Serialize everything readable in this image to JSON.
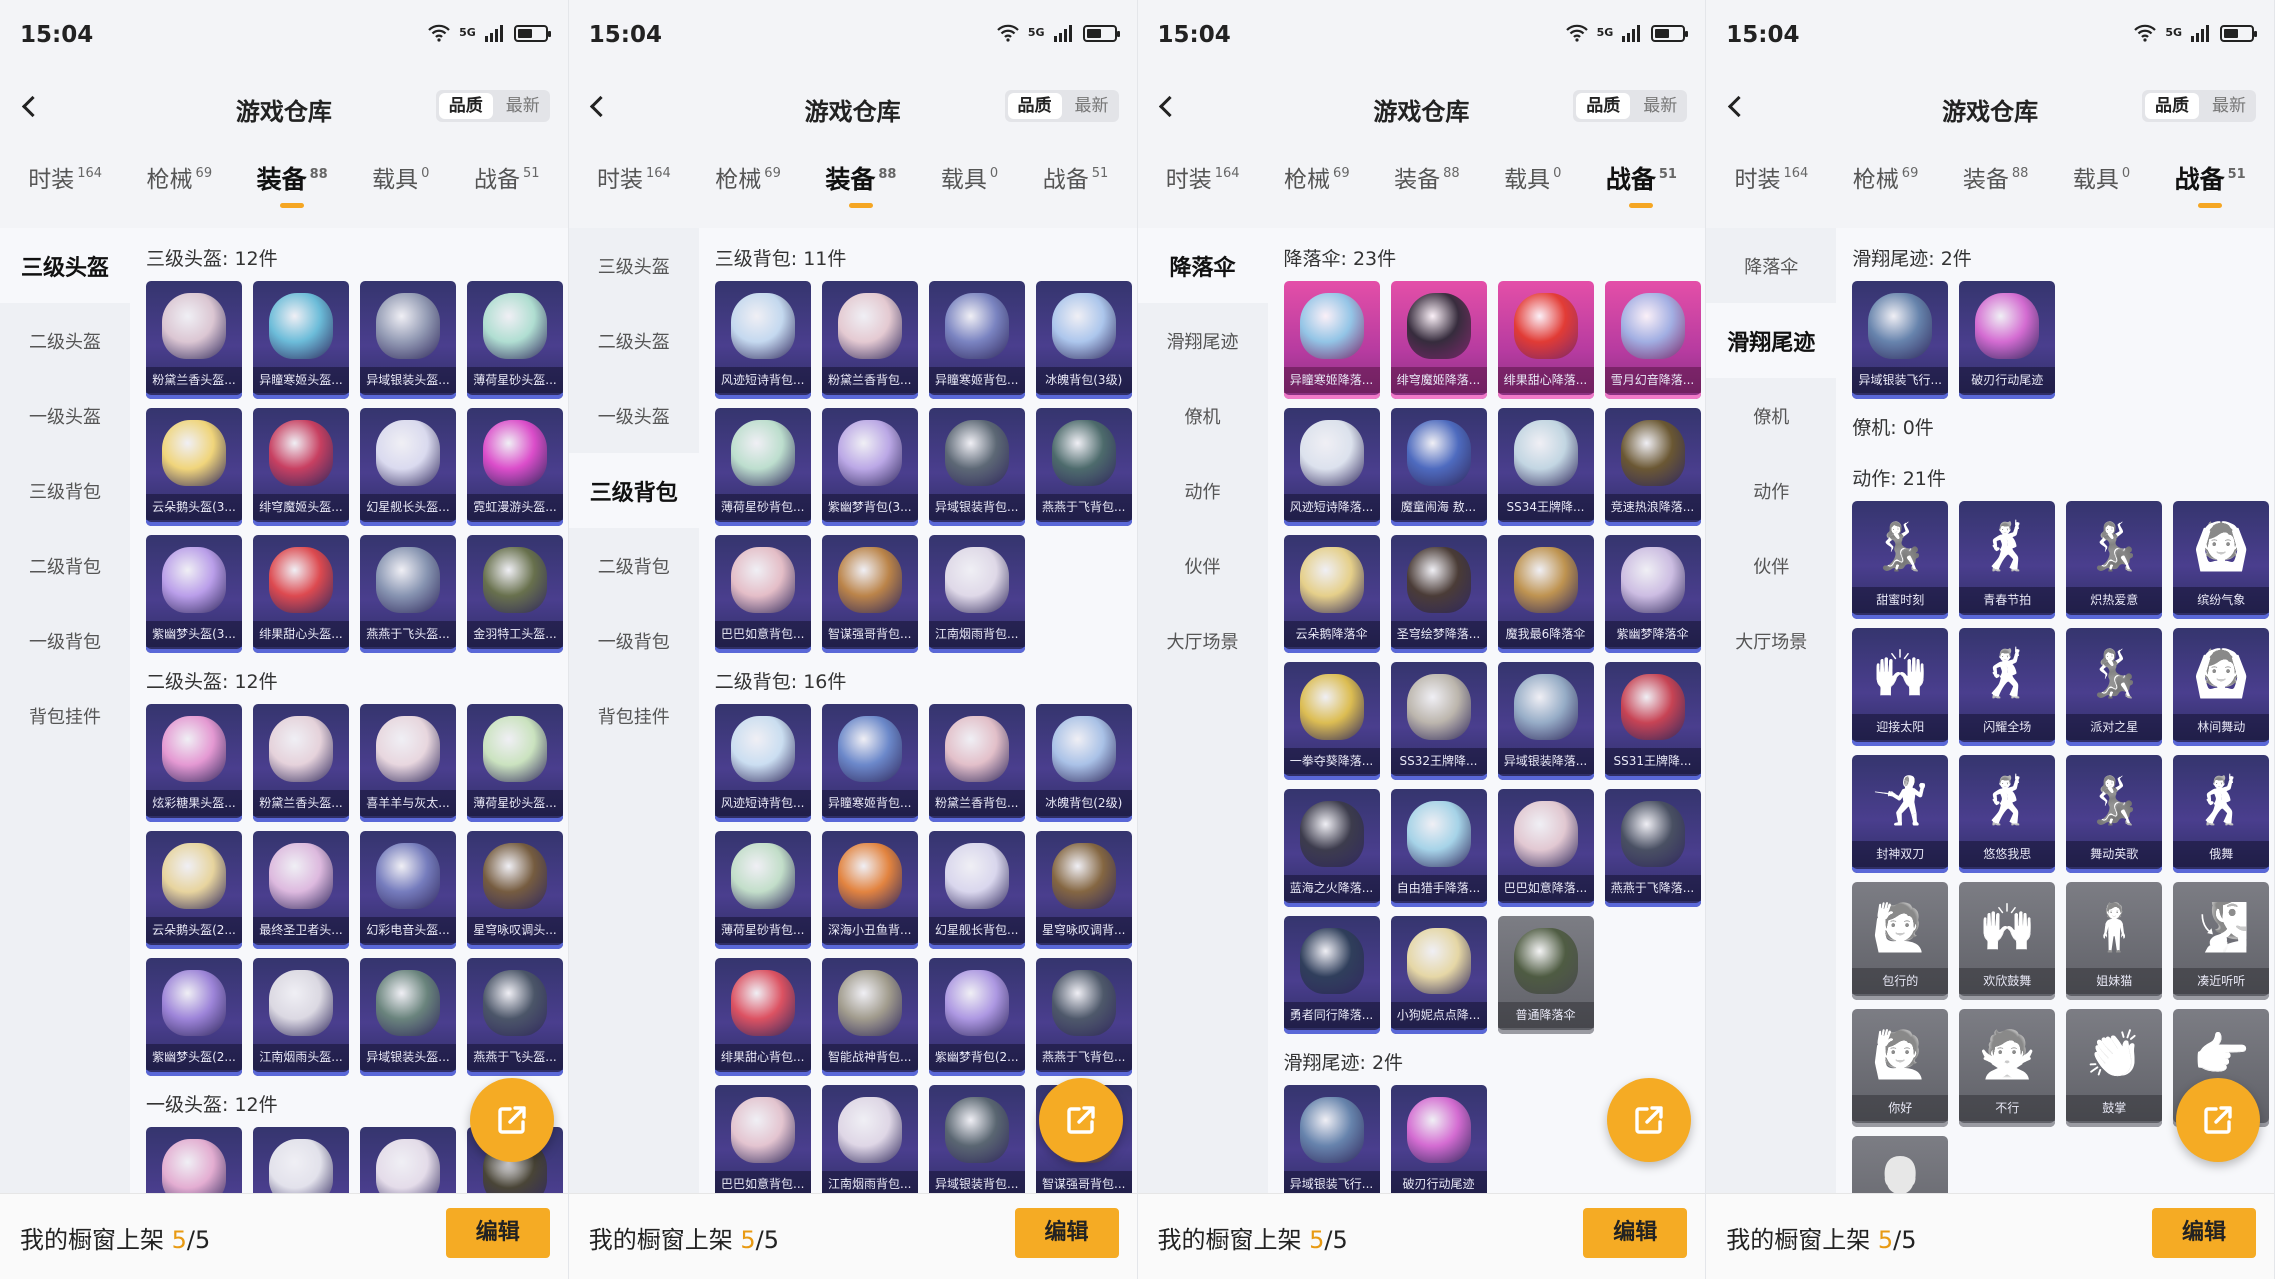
{
  "status": {
    "time": "15:04",
    "network": "5G"
  },
  "title": "游戏仓库",
  "sort": {
    "quality": "品质",
    "latest": "最新"
  },
  "tabs": [
    {
      "label": "时装",
      "count": "164"
    },
    {
      "label": "枪械",
      "count": "69"
    },
    {
      "label": "装备",
      "count": "88"
    },
    {
      "label": "载具",
      "count": "0"
    },
    {
      "label": "战备",
      "count": "51"
    }
  ],
  "footer": {
    "text": "我的橱窗上架 ",
    "count": "5",
    "total": "/5",
    "edit": "编辑"
  },
  "icons": {
    "back": "back-arrow-icon",
    "share": "share-external-icon",
    "wifi": "wifi-icon",
    "signal": "signal-icon",
    "battery": "battery-icon"
  },
  "colors": {
    "accent": "#f5a623",
    "card": "#3d3a7e",
    "legendary": "#d9479f"
  },
  "panels": [
    {
      "active_tab": 2,
      "categories": [
        "三级头盔",
        "二级头盔",
        "一级头盔",
        "三级背包",
        "二级背包",
        "一级背包",
        "背包挂件"
      ],
      "active_cat": 0,
      "sections": [
        {
          "title": "三级头盔: 12件",
          "items": [
            {
              "label": "粉黛兰香头盔...",
              "c": "#e8d2d9"
            },
            {
              "label": "异瞳寒姬头盔...",
              "c": "#6fc7e0"
            },
            {
              "label": "异域银装头盔...",
              "c": "#9aa3b8"
            },
            {
              "label": "薄荷星砂头盔...",
              "c": "#b9ecd8"
            },
            {
              "label": "云朵鹅头盔(3...",
              "c": "#ffe27a"
            },
            {
              "label": "绯穹魔姬头盔...",
              "c": "#d3405e"
            },
            {
              "label": "幻星舰长头盔...",
              "c": "#e7e8f8"
            },
            {
              "label": "霓虹漫游头盔...",
              "c": "#e84fd0"
            },
            {
              "label": "紫幽梦头盔(3...",
              "c": "#c4a7f2"
            },
            {
              "label": "绯果甜心头盔...",
              "c": "#ea4b4b"
            },
            {
              "label": "燕燕于飞头盔...",
              "c": "#8d9cb5"
            },
            {
              "label": "金羽特工头盔...",
              "c": "#6b7548"
            }
          ]
        },
        {
          "title": "二级头盔: 12件",
          "items": [
            {
              "label": "炫彩糖果头盔...",
              "c": "#f2a1d9"
            },
            {
              "label": "粉黛兰香头盔...",
              "c": "#f3dfe2"
            },
            {
              "label": "喜羊羊与灰太...",
              "c": "#f6e4e6"
            },
            {
              "label": "薄荷星砂头盔...",
              "c": "#d6f1c4"
            },
            {
              "label": "云朵鹅头盔(2...",
              "c": "#f5e1a0"
            },
            {
              "label": "最终圣卫者头...",
              "c": "#eac4e6"
            },
            {
              "label": "幻彩电音头盔...",
              "c": "#7a82c2"
            },
            {
              "label": "星穹咏叹调头...",
              "c": "#7a5f3a"
            },
            {
              "label": "紫幽梦头盔(2...",
              "c": "#a58be0"
            },
            {
              "label": "江南烟雨头盔...",
              "c": "#e8e6ea"
            },
            {
              "label": "异域银装头盔...",
              "c": "#6d8a7c"
            },
            {
              "label": "燕燕于飞头盔...",
              "c": "#4c5866"
            }
          ]
        },
        {
          "title": "一级头盔: 12件",
          "items": [
            {
              "label": "",
              "c": "#f1b7d8"
            },
            {
              "label": "",
              "c": "#f0f0f4"
            },
            {
              "label": "",
              "c": "#f2eaf2"
            },
            {
              "label": "",
              "c": "#4a4630"
            }
          ]
        }
      ]
    },
    {
      "active_tab": 2,
      "categories": [
        "三级头盔",
        "二级头盔",
        "一级头盔",
        "三级背包",
        "二级背包",
        "一级背包",
        "背包挂件"
      ],
      "active_cat": 3,
      "sections": [
        {
          "title": "三级背包: 11件",
          "items": [
            {
              "label": "风迹短诗背包...",
              "c": "#cfe6f8"
            },
            {
              "label": "粉黛兰香背包...",
              "c": "#f2d6d8"
            },
            {
              "label": "异瞳寒姬背包...",
              "c": "#7f8ac6"
            },
            {
              "label": "冰魄背包(3级)",
              "c": "#b5d2f5"
            },
            {
              "label": "薄荷星砂背包...",
              "c": "#c7ecd4"
            },
            {
              "label": "紫幽梦背包(3...",
              "c": "#c5b1ee"
            },
            {
              "label": "异域银装背包...",
              "c": "#5f6c74"
            },
            {
              "label": "燕燕于飞背包...",
              "c": "#4e6f6a"
            },
            {
              "label": "巴巴如意背包...",
              "c": "#f2c9cd"
            },
            {
              "label": "智谋强哥背包...",
              "c": "#c58a44"
            },
            {
              "label": "江南烟雨背包...",
              "c": "#ece6f0"
            }
          ]
        },
        {
          "title": "二级背包: 16件",
          "items": [
            {
              "label": "风迹短诗背包...",
              "c": "#d6ecfa"
            },
            {
              "label": "异瞳寒姬背包...",
              "c": "#6f8fd0"
            },
            {
              "label": "粉黛兰香背包...",
              "c": "#f0cbcf"
            },
            {
              "label": "冰魄背包(2级)",
              "c": "#b2cdef"
            },
            {
              "label": "薄荷星砂背包...",
              "c": "#cdeccf"
            },
            {
              "label": "深海小丑鱼背...",
              "c": "#f08a3a"
            },
            {
              "label": "幻星舰长背包...",
              "c": "#e6e4f6"
            },
            {
              "label": "星穹咏叹调背...",
              "c": "#8a6a3c"
            },
            {
              "label": "绯果甜心背包...",
              "c": "#e9545f"
            },
            {
              "label": "智能战神背包...",
              "c": "#a9a48e"
            },
            {
              "label": "紫幽梦背包(2...",
              "c": "#b6a0ea"
            },
            {
              "label": "燕燕于飞背包...",
              "c": "#4f5b68"
            },
            {
              "label": "巴巴如意背包...",
              "c": "#f1d0d6"
            },
            {
              "label": "江南烟雨背包...",
              "c": "#ece4ee"
            },
            {
              "label": "异域银装背包...",
              "c": "#5c6a70"
            },
            {
              "label": "智谋强哥背包...",
              "c": "#c48a46"
            }
          ]
        }
      ]
    },
    {
      "active_tab": 4,
      "categories": [
        "降落伞",
        "滑翔尾迹",
        "僚机",
        "动作",
        "伙伴",
        "大厅场景"
      ],
      "active_cat": 0,
      "sections": [
        {
          "title": "降落伞: 23件",
          "items": [
            {
              "label": "异瞳寒姬降落...",
              "c": "#8fd0ec",
              "v": "pink"
            },
            {
              "label": "绯穹魔姬降落...",
              "c": "#2a2a34",
              "v": "pink"
            },
            {
              "label": "绯果甜心降落...",
              "c": "#e43b2c",
              "v": "pink"
            },
            {
              "label": "雪月幻音降落...",
              "c": "#9fb8e8",
              "v": "pink"
            },
            {
              "label": "风迹短诗降落...",
              "c": "#e9f0f6"
            },
            {
              "label": "魔童闹海 敖...",
              "c": "#4f6fc4"
            },
            {
              "label": "SS34王牌降...",
              "c": "#cde3ea"
            },
            {
              "label": "竞速热浪降落...",
              "c": "#6e5a2c"
            },
            {
              "label": "云朵鹅降落伞",
              "c": "#f3dc8a"
            },
            {
              "label": "圣穹绘梦降落...",
              "c": "#4b3c30"
            },
            {
              "label": "魔我最6降落伞",
              "c": "#c99b4c"
            },
            {
              "label": "紫幽梦降落伞",
              "c": "#d8c8ea"
            },
            {
              "label": "一拳夺葵降落...",
              "c": "#e9c84e"
            },
            {
              "label": "SS32王牌降...",
              "c": "#c6c0b0"
            },
            {
              "label": "异域银装降落...",
              "c": "#9db6cc"
            },
            {
              "label": "SS31王牌降...",
              "c": "#d24450"
            },
            {
              "label": "蓝海之火降落...",
              "c": "#3c3c48"
            },
            {
              "label": "自由猎手降落...",
              "c": "#aee0f0"
            },
            {
              "label": "巴巴如意降落...",
              "c": "#efd4d8"
            },
            {
              "label": "燕燕于飞降落...",
              "c": "#4a5260"
            },
            {
              "label": "勇者同行降落...",
              "c": "#2e3f58"
            },
            {
              "label": "小狗妮点点降...",
              "c": "#f3e4a8"
            },
            {
              "label": "普通降落伞",
              "c": "#4c5a3e",
              "v": "gray"
            }
          ]
        },
        {
          "title": "滑翔尾迹: 2件",
          "items": [
            {
              "label": "异域银装飞行...",
              "c": "#6a8ab0"
            },
            {
              "label": "破刃行动尾迹",
              "c": "#e070d8"
            }
          ]
        }
      ]
    },
    {
      "active_tab": 4,
      "categories": [
        "降落伞",
        "滑翔尾迹",
        "僚机",
        "动作",
        "伙伴",
        "大厅场景"
      ],
      "active_cat": 1,
      "sections": [
        {
          "title": "滑翔尾迹: 2件",
          "items": [
            {
              "label": "异域银装飞行...",
              "c": "#6a8ab0"
            },
            {
              "label": "破刃行动尾迹",
              "c": "#e070d8"
            }
          ]
        },
        {
          "title": "僚机: 0件",
          "items": []
        },
        {
          "title": "动作: 21件",
          "items": [
            {
              "label": "甜蜜时刻",
              "c": "#f0f0ff",
              "g": "💃"
            },
            {
              "label": "青春节拍",
              "c": "#f0f0ff",
              "g": "🕺"
            },
            {
              "label": "炽热爱意",
              "c": "#f0f0ff",
              "g": "💃"
            },
            {
              "label": "缤纷气象",
              "c": "#f0f0ff",
              "g": "🙆"
            },
            {
              "label": "迎接太阳",
              "c": "#f0f0ff",
              "g": "🙌"
            },
            {
              "label": "闪耀全场",
              "c": "#f0f0ff",
              "g": "🕺"
            },
            {
              "label": "派对之星",
              "c": "#f0f0ff",
              "g": "💃"
            },
            {
              "label": "林间舞动",
              "c": "#f0f0ff",
              "g": "🙆"
            },
            {
              "label": "封神双刀",
              "c": "#f0f0ff",
              "g": "🤺"
            },
            {
              "label": "悠悠我思",
              "c": "#f0f0ff",
              "g": "🕺"
            },
            {
              "label": "舞动英歌",
              "c": "#f0f0ff",
              "g": "💃"
            },
            {
              "label": "俄舞",
              "c": "#f0f0ff",
              "g": "🕺"
            },
            {
              "label": "包行的",
              "c": "#fff",
              "g": "🙋",
              "v": "gray"
            },
            {
              "label": "欢欣鼓舞",
              "c": "#fff",
              "g": "🙌",
              "v": "gray"
            },
            {
              "label": "姐妹猫",
              "c": "#fff",
              "g": "🧍",
              "v": "gray"
            },
            {
              "label": "凑近听听",
              "c": "#fff",
              "g": "🧏",
              "v": "gray"
            },
            {
              "label": "你好",
              "c": "#fff",
              "g": "🙋",
              "v": "gray"
            },
            {
              "label": "不行",
              "c": "#fff",
              "g": "🙅",
              "v": "gray"
            },
            {
              "label": "鼓掌",
              "c": "#fff",
              "g": "👏",
              "v": "gray"
            },
            {
              "label": "",
              "c": "#fff",
              "g": "👉",
              "v": "gray"
            },
            {
              "label": "",
              "c": "#fff",
              "g": "👤",
              "v": "gray"
            }
          ]
        }
      ]
    }
  ]
}
